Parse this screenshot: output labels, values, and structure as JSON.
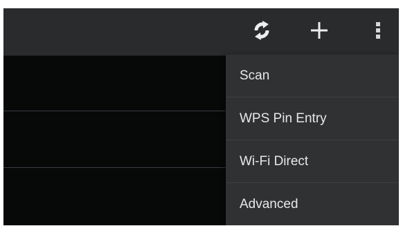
{
  "action_bar": {
    "icons": [
      "wps-push-button-icon",
      "add-network-icon",
      "overflow-menu-icon"
    ]
  },
  "overflow_menu": {
    "items": [
      {
        "label": "Scan"
      },
      {
        "label": "WPS Pin Entry"
      },
      {
        "label": "Wi-Fi Direct"
      },
      {
        "label": "Advanced"
      }
    ]
  },
  "colors": {
    "action_bar": "#2a2b2d",
    "menu_background": "#2f3133",
    "menu_text": "#e8e8e8",
    "list_background": "#050505",
    "divider": "#3a3e44"
  }
}
